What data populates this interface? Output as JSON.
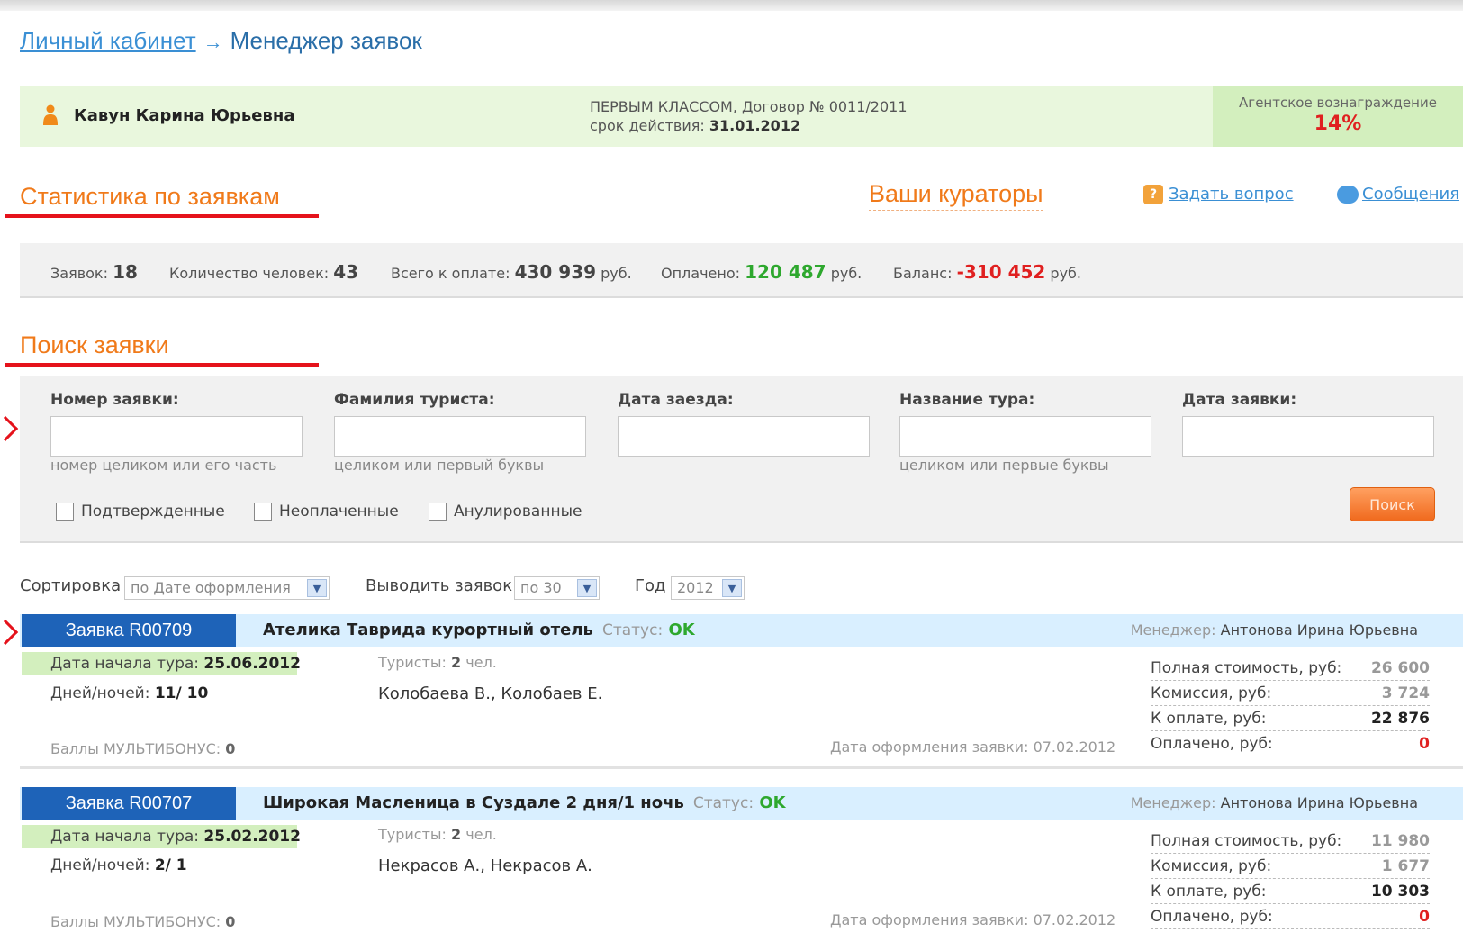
{
  "breadcrumb": {
    "home": "Личный кабинет",
    "arrow": "→",
    "current": "Менеджер заявок"
  },
  "user": {
    "name": "Кавун Карина Юрьевна",
    "contract_line": "ПЕРВЫМ КЛАССОМ, Договор № 0011/2011",
    "validity_label": "срок действия:",
    "validity_date": "31.01.2012"
  },
  "reward": {
    "label": "Агентское вознаграждение",
    "value": "14%"
  },
  "stats_section": {
    "title": "Статистика по заявкам"
  },
  "curators": {
    "title": "Ваши кураторы",
    "ask_label": "Задать вопрос",
    "messages_label": "Сообщения"
  },
  "stats": {
    "orders_label": "Заявок:",
    "orders": "18",
    "people_label": "Количество человек:",
    "people": "43",
    "total_label": "Всего к оплате:",
    "total": "430 939",
    "currency": "руб.",
    "paid_label": "Оплачено:",
    "paid": "120 487",
    "balance_label": "Баланс:",
    "balance": "-310 452"
  },
  "search": {
    "title": "Поиск заявки",
    "fields": [
      {
        "label": "Номер заявки:",
        "value": "",
        "hint": "номер целиком или его часть"
      },
      {
        "label": "Фамилия туриста:",
        "value": "",
        "hint": "целиком или первый буквы"
      },
      {
        "label": "Дата заезда:",
        "value": "",
        "hint": ""
      },
      {
        "label": "Название тура:",
        "value": "",
        "hint": "целиком или первые буквы"
      },
      {
        "label": "Дата заявки:",
        "value": "",
        "hint": ""
      }
    ],
    "checkboxes": [
      "Подтвержденные",
      "Неоплаченные",
      "Анулированные"
    ],
    "button": "Поиск"
  },
  "sorting": {
    "sort_label": "Сортировка",
    "sort_value": "по Дате оформления",
    "per_page_label": "Выводить заявок",
    "per_page_value": "по 30",
    "year_label": "Год",
    "year_value": "2012"
  },
  "orders": [
    {
      "number": "Заявка R00709",
      "title": "Ателика Таврида курортный отель",
      "status_label": "Статус:",
      "status": "OK",
      "manager_label": "Менеджер:",
      "manager": "Антонова Ирина Юрьевна",
      "start_label": "Дата начала тура:",
      "start": "25.06.2012",
      "days_label": "Дней/ночей:",
      "days": "11/ 10",
      "tourists_label": "Туристы:",
      "tourists_count": "2",
      "tourists_unit": "чел.",
      "tourist_names": "Колобаева В., Колобаев Е.",
      "bonus_label": "Баллы МУЛЬТИБОНУС:",
      "bonus": "0",
      "date_label": "Дата оформления заявки:",
      "date": "07.02.2012",
      "full_label": "Полная стоимость, руб:",
      "full": "26 600",
      "commission_label": "Комиссия, руб:",
      "commission": "3 724",
      "topay_label": "К оплате, руб:",
      "topay": "22 876",
      "paid_label": "Оплачено, руб:",
      "paid": "0"
    },
    {
      "number": "Заявка R00707",
      "title": "Широкая Масленица в Суздале 2 дня/1 ночь",
      "status_label": "Статус:",
      "status": "OK",
      "manager_label": "Менеджер:",
      "manager": "Антонова Ирина Юрьевна",
      "start_label": "Дата начала тура:",
      "start": "25.02.2012",
      "days_label": "Дней/ночей:",
      "days": "2/ 1",
      "tourists_label": "Туристы:",
      "tourists_count": "2",
      "tourists_unit": "чел.",
      "tourist_names": "Некрасов А., Некрасов А.",
      "bonus_label": "Баллы МУЛЬТИБОНУС:",
      "bonus": "0",
      "date_label": "Дата оформления заявки:",
      "date": "07.02.2012",
      "full_label": "Полная стоимость, руб:",
      "full": "11 980",
      "commission_label": "Комиссия, руб:",
      "commission": "1 677",
      "topay_label": "К оплате, руб:",
      "topay": "10 303",
      "paid_label": "Оплачено, руб:",
      "paid": "0"
    }
  ]
}
